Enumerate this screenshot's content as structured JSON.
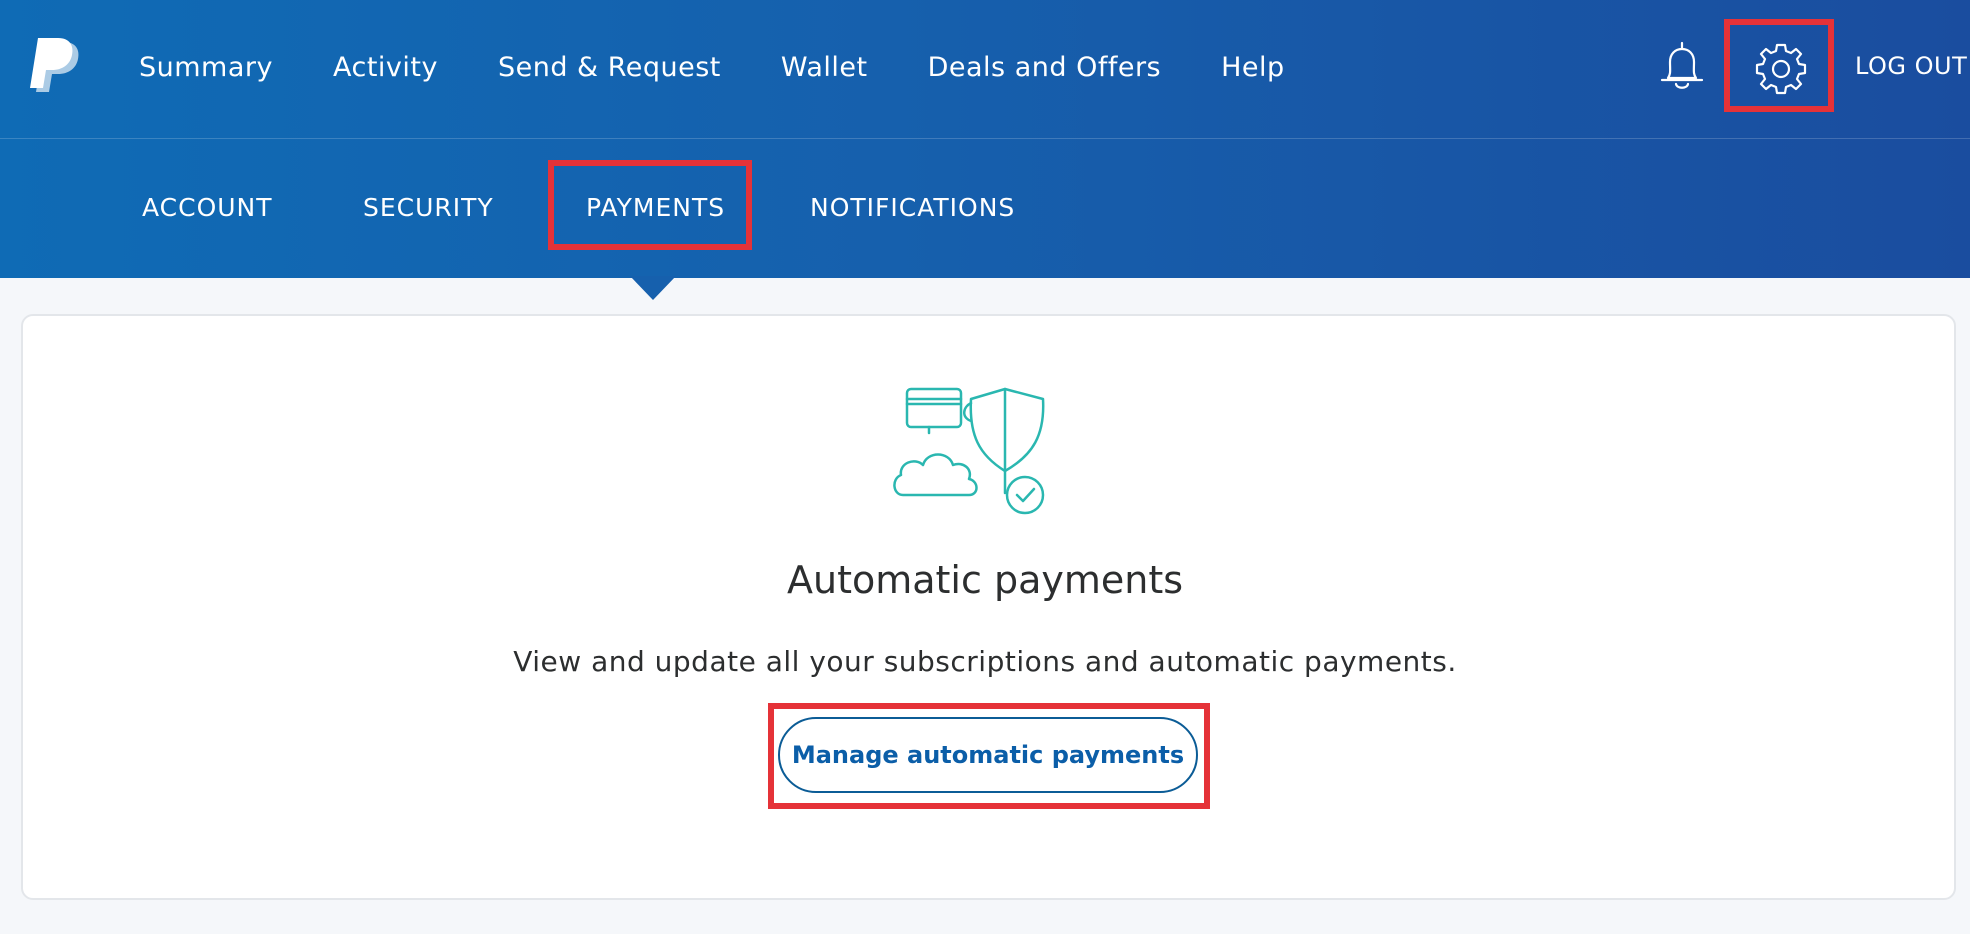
{
  "top_nav": {
    "logo": "paypal-logo",
    "links": [
      "Summary",
      "Activity",
      "Send & Request",
      "Wallet",
      "Deals and Offers",
      "Help"
    ],
    "notifications_icon": "bell-icon",
    "settings_icon": "gear-icon",
    "logout_label": "LOG OUT"
  },
  "sub_nav": {
    "tabs": [
      "ACCOUNT",
      "SECURITY",
      "PAYMENTS",
      "NOTIFICATIONS"
    ],
    "active_tab": "PAYMENTS"
  },
  "content": {
    "illustration": "automatic-payments-illustration",
    "title": "Automatic payments",
    "description": "View and update all your subscriptions and automatic payments.",
    "button_label": "Manage automatic payments"
  },
  "colors": {
    "header_gradient_start": "#0f6bb5",
    "header_gradient_end": "#1a4d9f",
    "highlight_box": "#e53238",
    "accent_teal": "#2ab7b0",
    "button_text": "#0b5ea8"
  }
}
